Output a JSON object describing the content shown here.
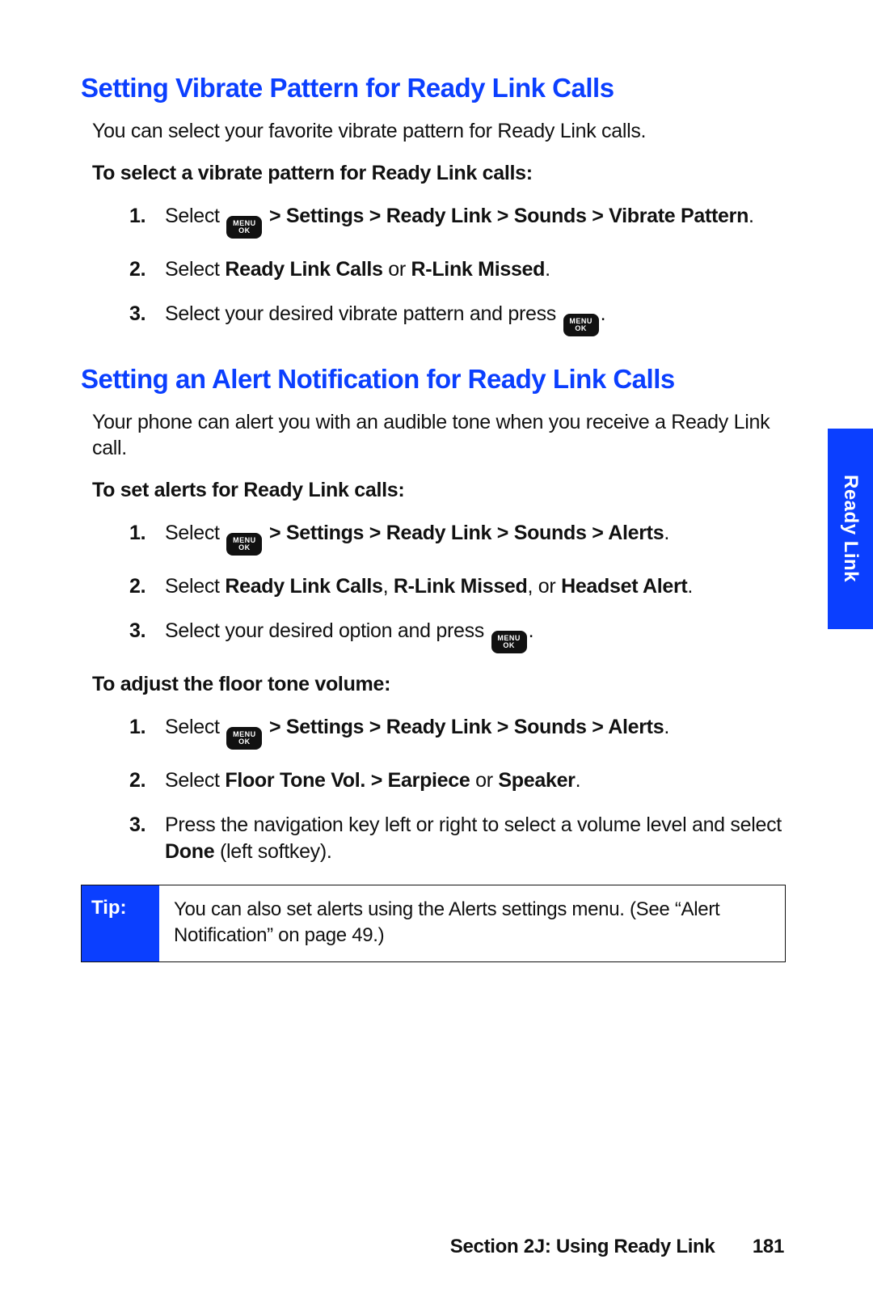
{
  "sideTab": "Ready Link",
  "section1": {
    "title": "Setting Vibrate Pattern for Ready Link Calls",
    "intro": "You can select your favorite vibrate pattern for Ready Link calls.",
    "sub": "To select a vibrate pattern for Ready Link calls:",
    "steps": {
      "n1": "1.",
      "s1a": "Select ",
      "s1b": " > Settings > Ready Link > Sounds > Vibrate Pattern",
      "s1c": ".",
      "n2": "2.",
      "s2a": "Select ",
      "s2b": "Ready Link Calls",
      "s2c": " or ",
      "s2d": "R-Link Missed",
      "s2e": ".",
      "n3": "3.",
      "s3a": "Select your desired vibrate pattern and press ",
      "s3b": "."
    }
  },
  "section2": {
    "title": "Setting an Alert Notification for Ready Link Calls",
    "intro": "Your phone can alert you with an audible tone when you receive a Ready Link call.",
    "subA": "To set alerts for Ready Link calls:",
    "stepsA": {
      "n1": "1.",
      "s1a": "Select ",
      "s1b": " > Settings > Ready Link > Sounds > Alerts",
      "s1c": ".",
      "n2": "2.",
      "s2a": "Select ",
      "s2b": "Ready Link Calls",
      "s2c": ", ",
      "s2d": "R-Link Missed",
      "s2e": ", or ",
      "s2f": "Headset Alert",
      "s2g": ".",
      "n3": "3.",
      "s3a": "Select your desired option and press ",
      "s3b": "."
    },
    "subB": "To adjust the floor tone volume:",
    "stepsB": {
      "n1": "1.",
      "s1a": "Select ",
      "s1b": " > Settings > Ready Link > Sounds > Alerts",
      "s1c": ".",
      "n2": "2.",
      "s2a": "Select ",
      "s2b": "Floor Tone Vol. > Earpiece",
      "s2c": " or ",
      "s2d": "Speaker",
      "s2e": ".",
      "n3": "3.",
      "s3a": "Press the navigation key left or right to select a volume level and select ",
      "s3b": "Done",
      "s3c": " (left softkey)."
    }
  },
  "tip": {
    "label": "Tip:",
    "text": "You can also set alerts using the Alerts settings menu. (See “Alert Notification” on page 49.)"
  },
  "footer": {
    "section": "Section 2J: Using Ready Link",
    "page": "181"
  },
  "icon": {
    "row1": "MENU",
    "row2": "OK"
  }
}
